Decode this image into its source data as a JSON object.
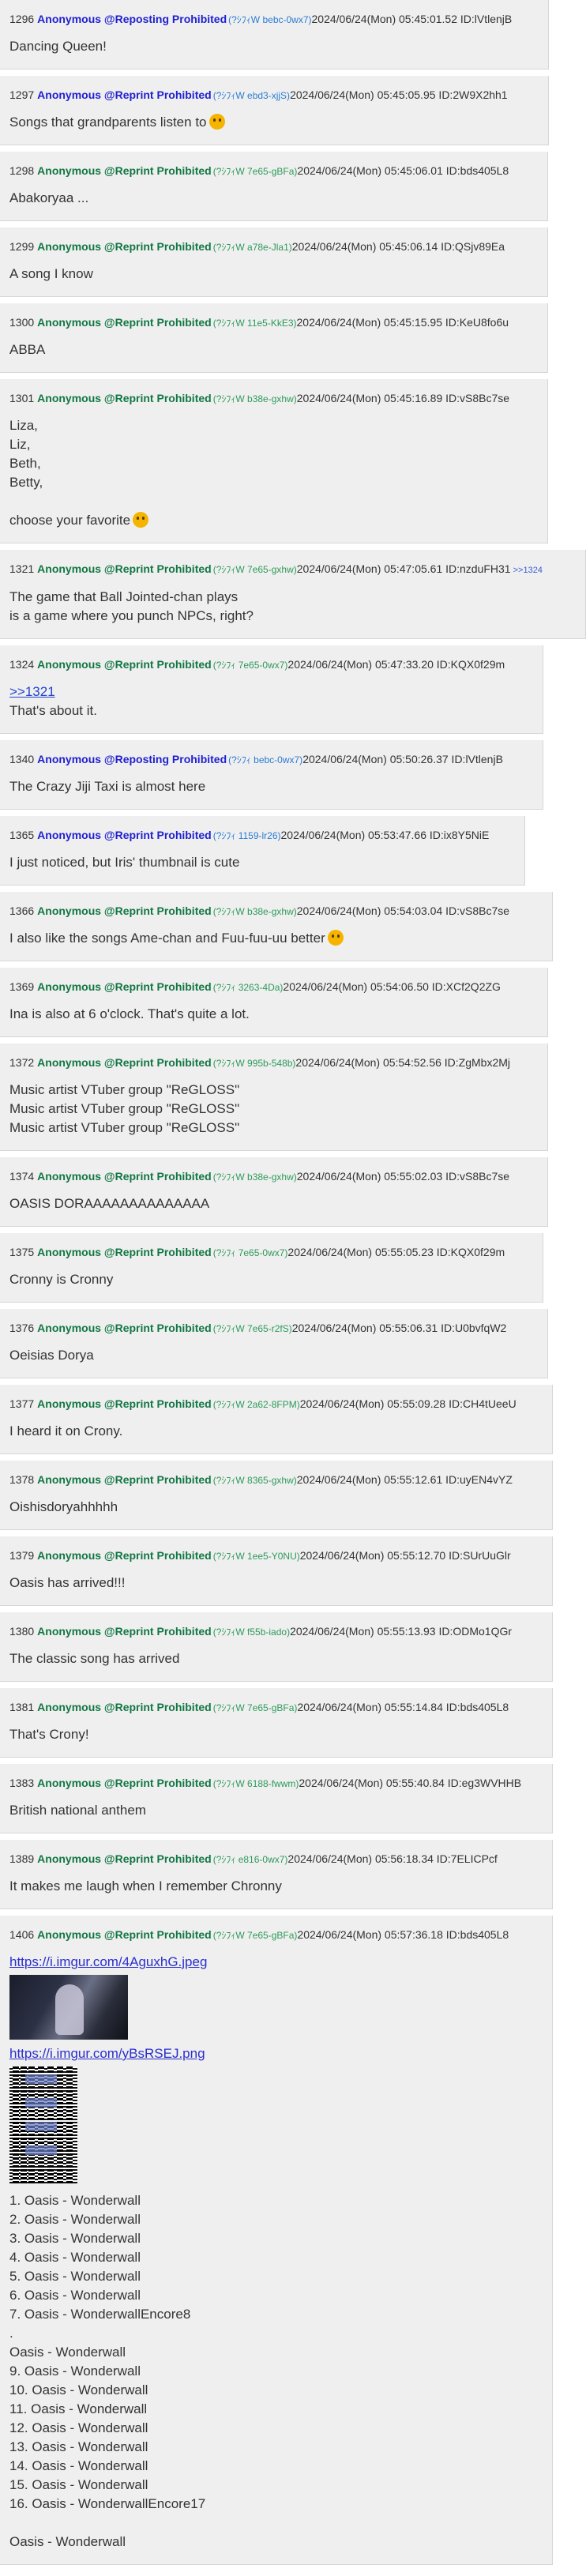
{
  "posts": [
    {
      "num": "1296",
      "name": "Anonymous @Reposting Prohibited",
      "name_color": "blue",
      "trip": "(?ｼﾌｨW bebc-0wx7)",
      "meta": "2024/06/24(Mon) 05:45:01.52 ID:lVtlenjB",
      "lines": [
        "Dancing Queen!"
      ]
    },
    {
      "num": "1297",
      "name": "Anonymous @Reprint Prohibited",
      "name_color": "blue",
      "trip": "(?ｼﾌｨW ebd3-xjjS)",
      "meta": "2024/06/24(Mon) 05:45:05.95 ID:2W9X2hh1",
      "lines": [
        "Songs that grandparents listen to"
      ],
      "emoji_line": 0
    },
    {
      "num": "1298",
      "name": "Anonymous @Reprint Prohibited",
      "name_color": "green",
      "trip": "(?ｼﾌｨW 7e65-gBFa)",
      "meta": "2024/06/24(Mon) 05:45:06.01 ID:bds405L8",
      "lines": [
        "Abakoryaa ..."
      ]
    },
    {
      "num": "1299",
      "name": "Anonymous @Reprint Prohibited",
      "name_color": "green",
      "trip": "(?ｼﾌｨW a78e-Jla1)",
      "meta": "2024/06/24(Mon) 05:45:06.14 ID:QSjv89Ea",
      "lines": [
        "A song I know"
      ]
    },
    {
      "num": "1300",
      "name": "Anonymous @Reprint Prohibited",
      "name_color": "green",
      "trip": "(?ｼﾌｨW 11e5-KkE3)",
      "meta": "2024/06/24(Mon) 05:45:15.95 ID:KeU8fo6u",
      "lines": [
        "ABBA"
      ]
    },
    {
      "num": "1301",
      "name": "Anonymous @Reprint Prohibited",
      "name_color": "green",
      "trip": "(?ｼﾌｨW b38e-gxhw)",
      "meta": "2024/06/24(Mon) 05:45:16.89 ID:vS8Bc7se",
      "lines": [
        "Liza,",
        "Liz,",
        "Beth,",
        "Betty,",
        "",
        "choose your favorite"
      ],
      "emoji_line": 5
    },
    {
      "num": "1321",
      "name": "Anonymous @Reprint Prohibited",
      "name_color": "green",
      "trip": "(?ｼﾌｨW 7e65-gxhw)",
      "meta": "2024/06/24(Mon) 05:47:05.61 ID:nzduFH31",
      "ref": ">>1324",
      "lines": [
        "The game that Ball Jointed-chan plays",
        "is a game where you punch NPCs, right?"
      ]
    },
    {
      "num": "1324",
      "name": "Anonymous @Reprint Prohibited",
      "name_color": "green",
      "trip": "(?ｼﾌｨ 7e65-0wx7)",
      "meta": "2024/06/24(Mon) 05:47:33.20 ID:KQX0f29m",
      "quote": ">>1321",
      "lines": [
        "That's about it."
      ]
    },
    {
      "num": "1340",
      "name": "Anonymous @Reposting Prohibited",
      "name_color": "blue",
      "trip": "(?ｼﾌｨ bebc-0wx7)",
      "meta": "2024/06/24(Mon) 05:50:26.37 ID:lVtlenjB",
      "lines": [
        "The Crazy Jiji Taxi is almost here"
      ]
    },
    {
      "num": "1365",
      "name": "Anonymous @Reprint Prohibited",
      "name_color": "blue",
      "trip": "(?ｼﾌｨ 1159-lr26)",
      "meta": "2024/06/24(Mon) 05:53:47.66 ID:ix8Y5NiE",
      "lines": [
        "I just noticed, but Iris' thumbnail is cute"
      ]
    },
    {
      "num": "1366",
      "name": "Anonymous @Reprint Prohibited",
      "name_color": "green",
      "trip": "(?ｼﾌｨW b38e-gxhw)",
      "meta": "2024/06/24(Mon) 05:54:03.04 ID:vS8Bc7se",
      "lines": [
        "I also like the songs Ame-chan and Fuu-fuu-uu better"
      ],
      "emoji_line": 0
    },
    {
      "num": "1369",
      "name": "Anonymous @Reprint Prohibited",
      "name_color": "green",
      "trip": "(?ｼﾌｨ 3263-4Da)",
      "meta": "2024/06/24(Mon) 05:54:06.50 ID:XCf2Q2ZG",
      "lines": [
        "Ina is also at 6 o'clock. That's quite a lot."
      ]
    },
    {
      "num": "1372",
      "name": "Anonymous @Reprint Prohibited",
      "name_color": "green",
      "trip": "(?ｼﾌｨW 995b-548b)",
      "meta": "2024/06/24(Mon) 05:54:52.56 ID:ZgMbx2Mj",
      "lines": [
        "Music artist VTuber group \"ReGLOSS\"",
        "Music artist VTuber group \"ReGLOSS\"",
        "Music artist VTuber group \"ReGLOSS\""
      ]
    },
    {
      "num": "1374",
      "name": "Anonymous @Reprint Prohibited",
      "name_color": "green",
      "trip": "(?ｼﾌｨW b38e-gxhw)",
      "meta": "2024/06/24(Mon) 05:55:02.03 ID:vS8Bc7se",
      "lines": [
        "OASIS DORAAAAAAAAAAAAAA"
      ]
    },
    {
      "num": "1375",
      "name": "Anonymous @Reprint Prohibited",
      "name_color": "green",
      "trip": "(?ｼﾌｨ 7e65-0wx7)",
      "meta": "2024/06/24(Mon) 05:55:05.23 ID:KQX0f29m",
      "lines": [
        "Cronny is Cronny"
      ]
    },
    {
      "num": "1376",
      "name": "Anonymous @Reprint Prohibited",
      "name_color": "green",
      "trip": "(?ｼﾌｨW 7e65-r2fS)",
      "meta": "2024/06/24(Mon) 05:55:06.31 ID:U0bvfqW2",
      "lines": [
        "Oeisias Dorya"
      ]
    },
    {
      "num": "1377",
      "name": "Anonymous @Reprint Prohibited",
      "name_color": "green",
      "trip": "(?ｼﾌｨW 2a62-8FPM)",
      "meta": "2024/06/24(Mon) 05:55:09.28 ID:CH4tUeeU",
      "lines": [
        "I heard it on Crony."
      ]
    },
    {
      "num": "1378",
      "name": "Anonymous @Reprint Prohibited",
      "name_color": "green",
      "trip": "(?ｼﾌｨW 8365-gxhw)",
      "meta": "2024/06/24(Mon) 05:55:12.61 ID:uyEN4vYZ",
      "lines": [
        "Oishisdoryahhhhh"
      ]
    },
    {
      "num": "1379",
      "name": "Anonymous @Reprint Prohibited",
      "name_color": "green",
      "trip": "(?ｼﾌｨW 1ee5-Y0NU)",
      "meta": "2024/06/24(Mon) 05:55:12.70 ID:SUrUuGlr",
      "lines": [
        "Oasis has arrived!!!"
      ]
    },
    {
      "num": "1380",
      "name": "Anonymous @Reprint Prohibited",
      "name_color": "green",
      "trip": "(?ｼﾌｨW f55b-iado)",
      "meta": "2024/06/24(Mon) 05:55:13.93 ID:ODMo1QGr",
      "lines": [
        "The classic song has arrived"
      ]
    },
    {
      "num": "1381",
      "name": "Anonymous @Reprint Prohibited",
      "name_color": "green",
      "trip": "(?ｼﾌｨW 7e65-gBFa)",
      "meta": "2024/06/24(Mon) 05:55:14.84 ID:bds405L8",
      "lines": [
        "That's Crony!"
      ]
    },
    {
      "num": "1383",
      "name": "Anonymous @Reprint Prohibited",
      "name_color": "green",
      "trip": "(?ｼﾌｨW 6188-fwwm)",
      "meta": "2024/06/24(Mon) 05:55:40.84 ID:eg3WVHHB",
      "lines": [
        "British national anthem"
      ]
    },
    {
      "num": "1389",
      "name": "Anonymous @Reprint Prohibited",
      "name_color": "green",
      "trip": "(?ｼﾌｨ e816-0wx7)",
      "meta": "2024/06/24(Mon) 05:56:18.34 ID:7ELICPcf",
      "lines": [
        "It makes me laugh when I remember Chronny"
      ]
    },
    {
      "num": "1406",
      "name": "Anonymous @Reprint Prohibited",
      "name_color": "green",
      "trip": "(?ｼﾌｨW 7e65-gBFa)",
      "meta": "2024/06/24(Mon) 05:57:36.18 ID:bds405L8",
      "link1": "https://i.imgur.com/4AguxhG.jpeg",
      "link2": "https://i.imgur.com/yBsRSEJ.png",
      "lines": [
        "1. Oasis - Wonderwall",
        "2. Oasis - Wonderwall",
        "3. Oasis - Wonderwall",
        "4. Oasis - Wonderwall",
        "5. Oasis - Wonderwall",
        "6. Oasis - Wonderwall",
        "7. Oasis - WonderwallEncore8",
        ".",
        "Oasis - Wonderwall",
        "9. Oasis - Wonderwall",
        "10. Oasis - Wonderwall",
        "11. Oasis - Wonderwall",
        "12. Oasis - Wonderwall",
        "13. Oasis - Wonderwall",
        "14. Oasis - Wonderwall",
        "15. Oasis - Wonderwall",
        "16. Oasis - WonderwallEncore17",
        "",
        "Oasis - Wonderwall"
      ]
    }
  ]
}
